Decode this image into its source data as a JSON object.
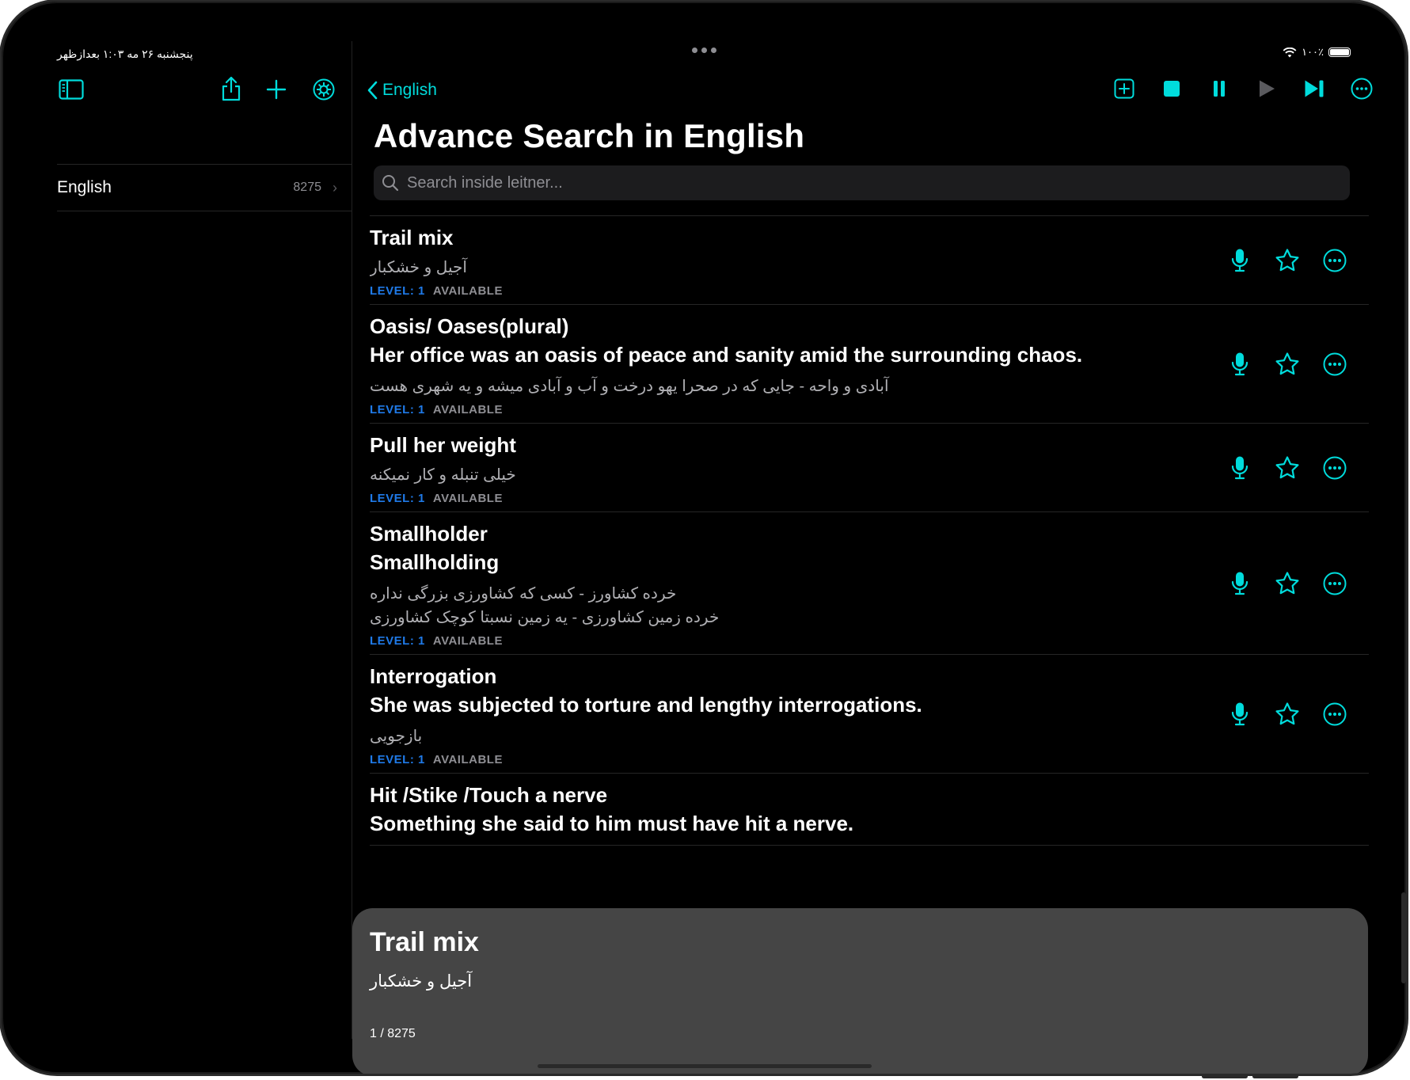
{
  "status": {
    "datetime": "پنجشنبه ۲۶ مه  ۱:۰۳ بعدازظهر",
    "battery": "۱۰۰٪"
  },
  "sidebar": {
    "icons": [
      "sidebar-toggle-icon",
      "share-icon",
      "plus-icon",
      "gear-icon"
    ],
    "items": [
      {
        "label": "English",
        "count": "8275"
      }
    ]
  },
  "header": {
    "back_label": "English",
    "title": "Advance Search in English",
    "toolbar_icons": [
      "add-square-icon",
      "stop-icon",
      "pause-icon",
      "play-icon",
      "skip-forward-icon",
      "more-icon"
    ]
  },
  "search": {
    "placeholder": "Search inside leitner..."
  },
  "colors": {
    "accent": "#00dcdc",
    "level": "#1f7ae8",
    "panel": "#454545"
  },
  "list": {
    "items": [
      {
        "title": "Trail mix",
        "sentence": "",
        "meaning": [
          "آجیل و خشکبار"
        ],
        "level": "LEVEL: 1",
        "status": "AVAILABLE"
      },
      {
        "title": "Oasis/ Oases(plural)",
        "sentence": "Her office was an oasis of peace and sanity amid the surrounding chaos.",
        "meaning": [
          "آبادی و واحه - جایی که در صحرا یهو درخت و آب و آبادی میشه و یه شهری هست"
        ],
        "level": "LEVEL: 1",
        "status": "AVAILABLE"
      },
      {
        "title": "Pull her weight",
        "sentence": "",
        "meaning": [
          "خیلی تنبله و کار نمیکنه"
        ],
        "level": "LEVEL: 1",
        "status": "AVAILABLE"
      },
      {
        "title": "Smallholder",
        "sentence": "Smallholding",
        "meaning": [
          "خرده کشاورز - کسی که کشاورزی بزرگی نداره",
          "خرده زمین کشاورزی - یه زمین نسبتا کوچک کشاورزی"
        ],
        "level": "LEVEL: 1",
        "status": "AVAILABLE"
      },
      {
        "title": "Interrogation",
        "sentence": "She was subjected to torture and lengthy interrogations.",
        "meaning": [
          "بازجویی"
        ],
        "level": "LEVEL: 1",
        "status": "AVAILABLE"
      },
      {
        "title": "Hit /Stike /Touch a nerve",
        "sentence": "Something she said to him must have hit a nerve.",
        "meaning": [],
        "level": "",
        "status": ""
      }
    ]
  },
  "player": {
    "title": "Trail mix",
    "meaning": "آجیل و خشکبار",
    "counter": "1 / 8275"
  }
}
